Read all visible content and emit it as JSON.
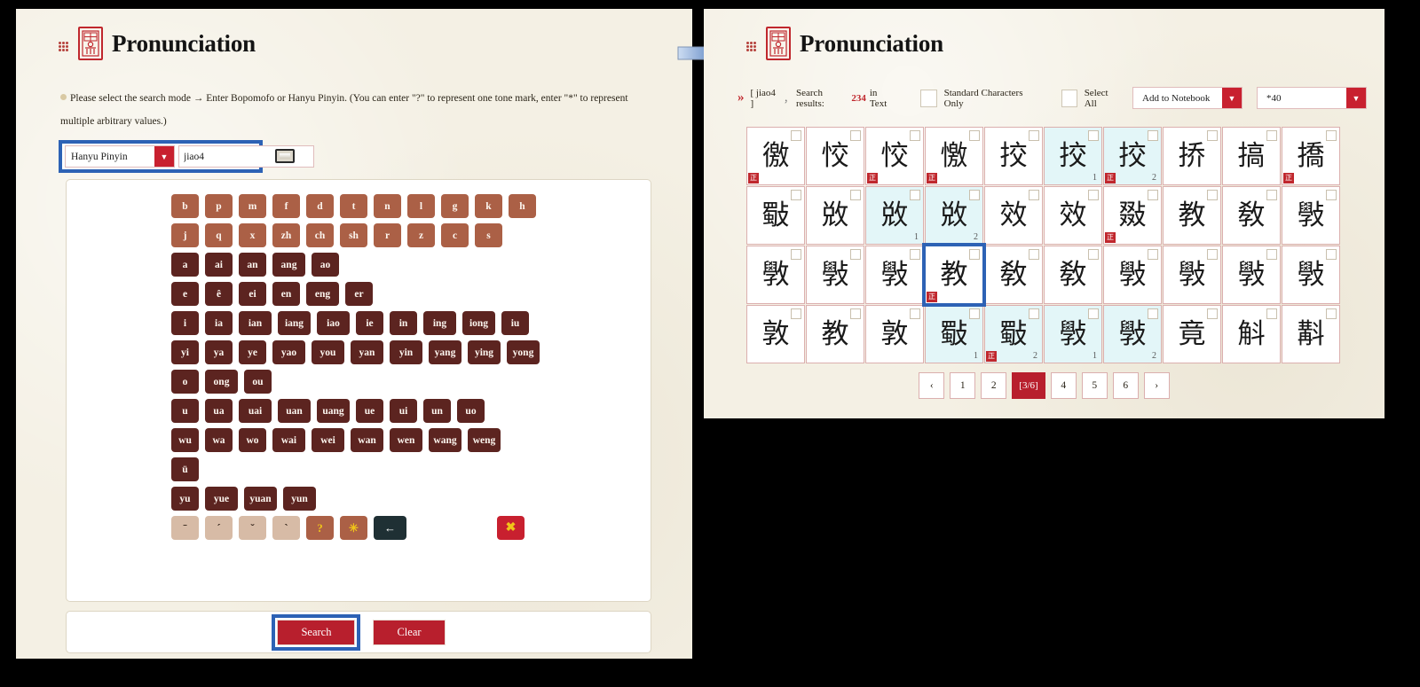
{
  "left": {
    "title": "Pronunciation",
    "logo_icon": "seal-logo-icon",
    "dots_icon": "grip-dots-icon",
    "hint": "Please select the search mode → Enter Bopomofo or Hanyu Pinyin. (You can enter \"?\" to represent one tone mark, enter \"*\" to represent multiple arbitrary values.)",
    "search_mode": {
      "selected": "Hanyu Pinyin",
      "arrow_icon": "chevron-down-icon"
    },
    "query_input": {
      "value": "jiao4",
      "placeholder": ""
    },
    "keyboard_toggle_icon": "keyboard-icon",
    "keyboard": {
      "rows": [
        {
          "type": "initial",
          "keys": [
            "b",
            "p",
            "m",
            "f",
            "d",
            "t",
            "n",
            "l",
            "g",
            "k",
            "h"
          ]
        },
        {
          "type": "initial",
          "keys": [
            "j",
            "q",
            "x",
            "zh",
            "ch",
            "sh",
            "r",
            "z",
            "c",
            "s"
          ]
        },
        {
          "type": "final",
          "keys": [
            "a",
            "ai",
            "an",
            "ang",
            "ao"
          ]
        },
        {
          "type": "final",
          "keys": [
            "e",
            "ê",
            "ei",
            "en",
            "eng",
            "er"
          ]
        },
        {
          "type": "final",
          "keys": [
            "i",
            "ia",
            "ian",
            "iang",
            "iao",
            "ie",
            "in",
            "ing",
            "iong",
            "iu"
          ]
        },
        {
          "type": "final",
          "keys": [
            "yi",
            "ya",
            "ye",
            "yao",
            "you",
            "yan",
            "yin",
            "yang",
            "ying",
            "yong"
          ]
        },
        {
          "type": "final",
          "keys": [
            "o",
            "ong",
            "ou"
          ]
        },
        {
          "type": "final",
          "keys": [
            "u",
            "ua",
            "uai",
            "uan",
            "uang",
            "ue",
            "ui",
            "un",
            "uo"
          ]
        },
        {
          "type": "final",
          "keys": [
            "wu",
            "wa",
            "wo",
            "wai",
            "wei",
            "wan",
            "wen",
            "wang",
            "weng"
          ]
        },
        {
          "type": "final",
          "keys": [
            "ü"
          ]
        },
        {
          "type": "final",
          "keys": [
            "yu",
            "yue",
            "yuan",
            "yun"
          ]
        }
      ],
      "tone_row": [
        {
          "label": "ˉ",
          "kind": "tone",
          "name": "tone-macron-key"
        },
        {
          "label": "ˊ",
          "kind": "tone",
          "name": "tone-acute-key"
        },
        {
          "label": "ˇ",
          "kind": "tone",
          "name": "tone-caron-key"
        },
        {
          "label": "ˋ",
          "kind": "tone",
          "name": "tone-grave-key"
        },
        {
          "label": "?",
          "kind": "qm",
          "name": "wildcard-single-key"
        },
        {
          "label": "✳",
          "kind": "star",
          "name": "wildcard-multi-key"
        },
        {
          "label": "←",
          "kind": "back",
          "name": "backspace-key"
        }
      ],
      "clear_key": {
        "label": "✖",
        "name": "clear-all-key"
      }
    },
    "footer": {
      "search_label": "Search",
      "clear_label": "Clear"
    }
  },
  "arrow_icon": "blue-right-arrow-icon",
  "right": {
    "title": "Pronunciation",
    "logo_icon": "seal-logo-icon",
    "dots_icon": "grip-dots-icon",
    "results": {
      "chevron_icon": "double-chevron-right-icon",
      "query": "[ jiao4 ]",
      "separator": "，",
      "label": "Search results:",
      "count": "234",
      "in_text": "in Text"
    },
    "toolbar": {
      "standard_only_label": "Standard Characters Only",
      "select_all_label": "Select All",
      "add_to_notebook_label": "Add to Notebook",
      "page_size_label": "*40",
      "dropdown_arrow_icon": "chevron-down-icon"
    },
    "grid": {
      "columns": 10,
      "cells": [
        {
          "char": "徼",
          "zheng": true,
          "hl": false,
          "num": "",
          "sel": false
        },
        {
          "char": "恔",
          "zheng": false,
          "hl": false,
          "num": "",
          "sel": false
        },
        {
          "char": "恔",
          "zheng": true,
          "hl": false,
          "num": "",
          "sel": false
        },
        {
          "char": "憿",
          "zheng": true,
          "hl": false,
          "num": "",
          "sel": false
        },
        {
          "char": "挍",
          "zheng": false,
          "hl": false,
          "num": "",
          "sel": false
        },
        {
          "char": "挍",
          "zheng": false,
          "hl": true,
          "num": "1",
          "sel": false
        },
        {
          "char": "挍",
          "zheng": true,
          "hl": true,
          "num": "2",
          "sel": false
        },
        {
          "char": "挢",
          "zheng": false,
          "hl": false,
          "num": "",
          "sel": false
        },
        {
          "char": "搞",
          "zheng": false,
          "hl": false,
          "num": "",
          "sel": false
        },
        {
          "char": "撟",
          "zheng": true,
          "hl": false,
          "num": "",
          "sel": false
        },
        {
          "char": "斀",
          "zheng": false,
          "hl": false,
          "num": "",
          "sel": false
        },
        {
          "char": "敚",
          "zheng": false,
          "hl": false,
          "num": "",
          "sel": false
        },
        {
          "char": "敚",
          "zheng": false,
          "hl": true,
          "num": "1",
          "sel": false
        },
        {
          "char": "敚",
          "zheng": false,
          "hl": true,
          "num": "2",
          "sel": false
        },
        {
          "char": "效",
          "zheng": false,
          "hl": false,
          "num": "",
          "sel": false
        },
        {
          "char": "效",
          "zheng": false,
          "hl": false,
          "num": "",
          "sel": false
        },
        {
          "char": "敠",
          "zheng": true,
          "hl": false,
          "num": "",
          "sel": false
        },
        {
          "char": "教",
          "zheng": false,
          "hl": false,
          "num": "",
          "sel": false
        },
        {
          "char": "敎",
          "zheng": false,
          "hl": false,
          "num": "",
          "sel": false
        },
        {
          "char": "斅",
          "zheng": false,
          "hl": false,
          "num": "",
          "sel": false
        },
        {
          "char": "斆",
          "zheng": false,
          "hl": false,
          "num": "",
          "sel": false
        },
        {
          "char": "斅",
          "zheng": false,
          "hl": false,
          "num": "",
          "sel": false
        },
        {
          "char": "斅",
          "zheng": false,
          "hl": false,
          "num": "",
          "sel": false
        },
        {
          "char": "教",
          "zheng": true,
          "hl": false,
          "num": "",
          "sel": true
        },
        {
          "char": "敎",
          "zheng": false,
          "hl": false,
          "num": "",
          "sel": false
        },
        {
          "char": "敎",
          "zheng": false,
          "hl": false,
          "num": "",
          "sel": false
        },
        {
          "char": "斅",
          "zheng": false,
          "hl": false,
          "num": "",
          "sel": false
        },
        {
          "char": "斅",
          "zheng": false,
          "hl": false,
          "num": "",
          "sel": false
        },
        {
          "char": "斅",
          "zheng": false,
          "hl": false,
          "num": "",
          "sel": false
        },
        {
          "char": "斅",
          "zheng": false,
          "hl": false,
          "num": "",
          "sel": false
        },
        {
          "char": "敦",
          "zheng": false,
          "hl": false,
          "num": "",
          "sel": false
        },
        {
          "char": "教",
          "zheng": false,
          "hl": false,
          "num": "",
          "sel": false
        },
        {
          "char": "敦",
          "zheng": false,
          "hl": false,
          "num": "",
          "sel": false
        },
        {
          "char": "斀",
          "zheng": false,
          "hl": true,
          "num": "1",
          "sel": false
        },
        {
          "char": "斀",
          "zheng": true,
          "hl": true,
          "num": "2",
          "sel": false
        },
        {
          "char": "斅",
          "zheng": false,
          "hl": true,
          "num": "1",
          "sel": false
        },
        {
          "char": "斅",
          "zheng": false,
          "hl": true,
          "num": "2",
          "sel": false
        },
        {
          "char": "竟",
          "zheng": false,
          "hl": false,
          "num": "",
          "sel": false
        },
        {
          "char": "斛",
          "zheng": false,
          "hl": false,
          "num": "",
          "sel": false
        },
        {
          "char": "斠",
          "zheng": false,
          "hl": false,
          "num": "",
          "sel": false
        }
      ]
    },
    "pagination": {
      "prev_icon": "chevron-left-icon",
      "next_icon": "chevron-right-icon",
      "pages": [
        "1",
        "2",
        "[3/6]",
        "4",
        "5",
        "6"
      ],
      "active": "[3/6]"
    }
  },
  "colors": {
    "brand_red": "#c0272d",
    "accent_blue": "#2d62b5",
    "paper": "#f4f0e4",
    "key_initial": "#ab6046",
    "key_final": "#5c2420",
    "highlight": "#e3f6f8"
  }
}
